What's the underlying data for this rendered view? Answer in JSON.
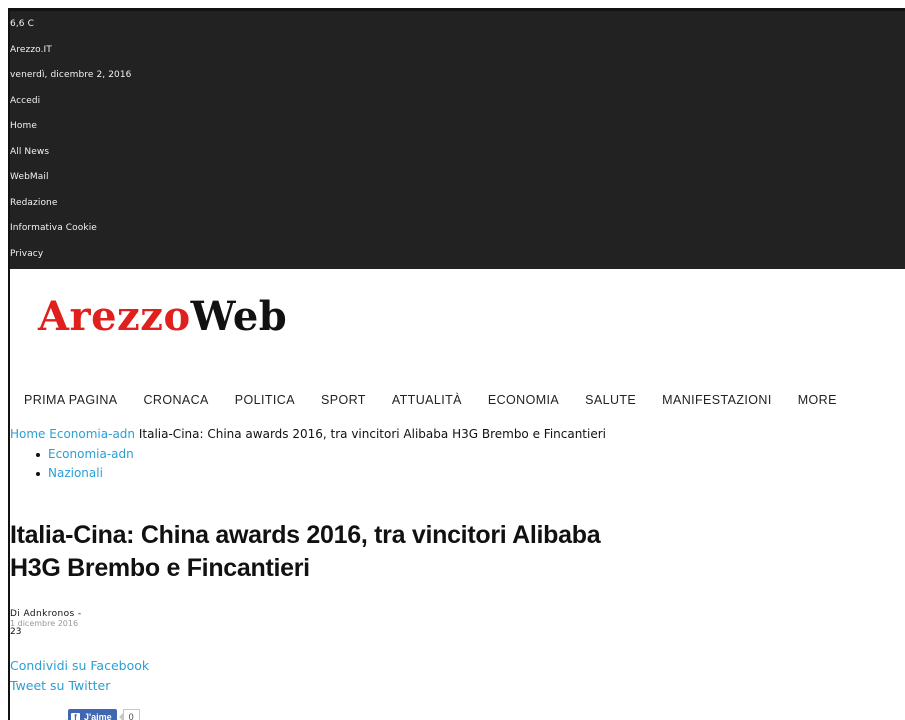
{
  "topbar": {
    "rows": [
      "6,6 C",
      "Arezzo.IT",
      "venerdì, dicembre 2, 2016",
      "Accedi",
      "Home",
      "All News",
      "WebMail",
      "Redazione",
      "Informativa Cookie",
      "Privacy"
    ]
  },
  "logo": {
    "part1": "Arezzo",
    "part2": "Web"
  },
  "nav": [
    "PRIMA PAGINA",
    "CRONACA",
    "POLITICA",
    "SPORT",
    "ATTUALITÀ",
    "ECONOMIA",
    "SALUTE",
    "MANIFESTAZIONI",
    "MORE"
  ],
  "breadcrumb": {
    "home": "Home",
    "section": "Economia-adn",
    "current": "Italia-Cina: China awards 2016, tra vincitori Alibaba H3G Brembo e Fincantieri"
  },
  "categories": [
    "Economia-adn",
    "Nazionali"
  ],
  "article": {
    "title_line1": "Italia-Cina: China awards 2016, tra vincitori Alibaba",
    "title_line2": "H3G Brembo e Fincantieri",
    "author": "Di Adnkronos -",
    "date": "1 dicembre 2016",
    "count": "23"
  },
  "share": {
    "facebook": "Condividi su Facebook",
    "twitter": "Tweet su Twitter"
  },
  "like": {
    "label": "J'aime",
    "count": "0"
  },
  "colors": {
    "accent": "#2a9fd6",
    "logo_red": "#e0201c",
    "topbar_bg": "#222222",
    "fb_blue": "#4267b2"
  }
}
